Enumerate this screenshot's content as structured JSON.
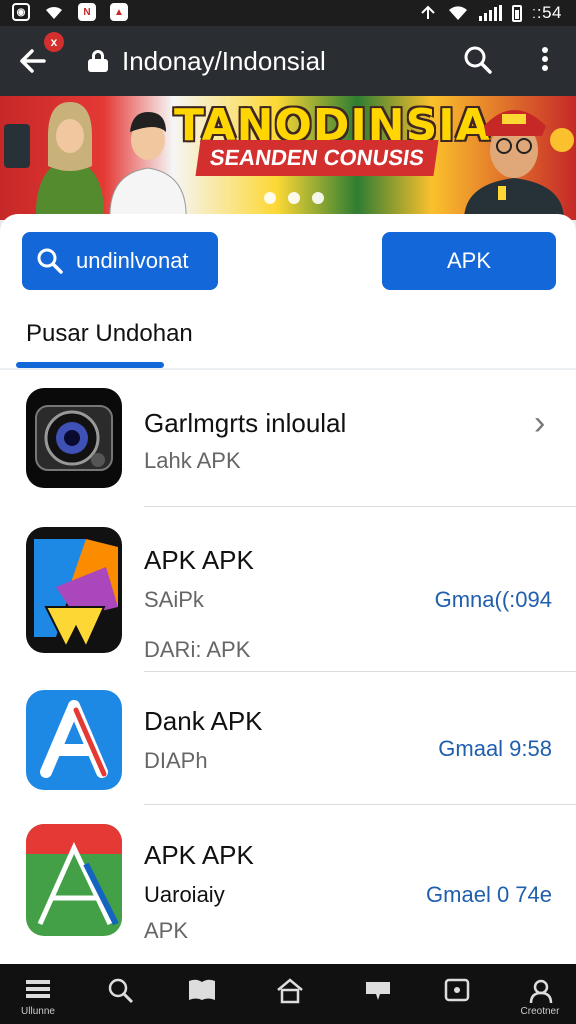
{
  "status_bar": {
    "time": "ː:54",
    "left_icons": [
      "notification-icon",
      "wifi-icon",
      "app-icon",
      "alert-icon"
    ]
  },
  "toolbar": {
    "back_badge": "x",
    "url": "Indonay/Indonsial"
  },
  "banner": {
    "title": "TANODINSIA",
    "subtitle": "SEANDEN CONUSIS"
  },
  "actions": {
    "search_label": "undinlvonat",
    "apk_label": "APK"
  },
  "section": {
    "title": "Pusar Undohan"
  },
  "items": [
    {
      "name": "Garlmgrts inloulal",
      "sub1": "Lahk APK",
      "sub2": "",
      "meta": ""
    },
    {
      "name": "APK APK",
      "sub1": "SAiPk",
      "sub2": "DARi: APK",
      "meta": "Gmna((:094"
    },
    {
      "name": "Dank APK",
      "sub1": "DIAPh",
      "sub2": "",
      "meta": "Gmaal 9:58"
    },
    {
      "name": "APK APK",
      "sub1": "Uaroiaiy",
      "sub2": "APK",
      "meta": "Gmael 0 74e"
    }
  ],
  "bottom_nav": {
    "first_label": "Ullunne",
    "last_label": "Creotner"
  },
  "colors": {
    "accent": "#1467d8",
    "top_bar": "#2a2d31",
    "meta_text": "#1f5fae"
  }
}
